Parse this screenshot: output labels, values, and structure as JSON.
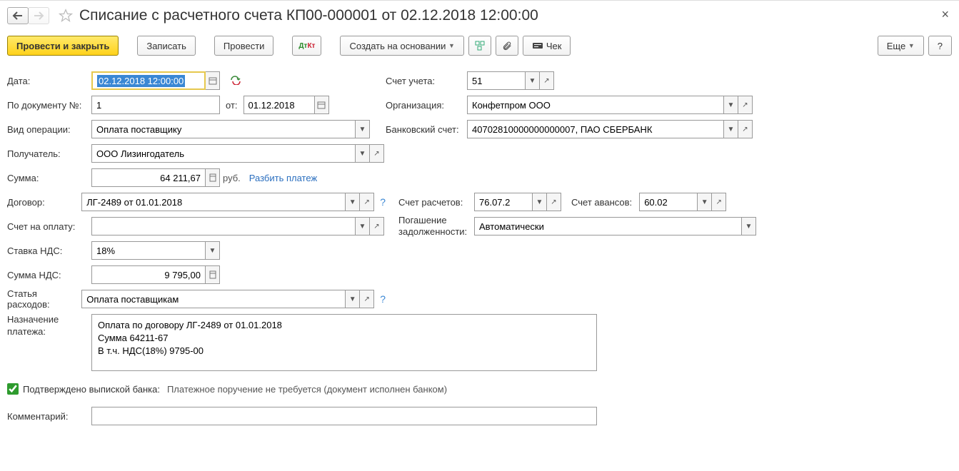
{
  "title": "Списание с расчетного счета КП00-000001 от 02.12.2018 12:00:00",
  "toolbar": {
    "post_and_close": "Провести и закрыть",
    "save": "Записать",
    "post": "Провести",
    "create_based": "Создать на основании",
    "check": "Чек",
    "more": "Еще",
    "help": "?"
  },
  "labels": {
    "date": "Дата:",
    "by_doc_no": "По документу №:",
    "from": "от:",
    "op_type": "Вид операции:",
    "recipient": "Получатель:",
    "amount": "Сумма:",
    "currency": "руб.",
    "split": "Разбить платеж",
    "contract": "Договор:",
    "invoice": "Счет на оплату:",
    "vat_rate": "Ставка НДС:",
    "vat_amount": "Сумма НДС:",
    "expense_item": "Статья расходов:",
    "purpose": "Назначение платежа:",
    "confirmed": "Подтверждено выпиской банка:",
    "confirmed_note": "Платежное поручение не требуется (документ исполнен банком)",
    "comment": "Комментарий:",
    "account": "Счет учета:",
    "org": "Организация:",
    "bank_acc": "Банковский счет:",
    "settle_acc": "Счет расчетов:",
    "advance_acc": "Счет авансов:",
    "debt_repay": "Погашение задолженности:"
  },
  "values": {
    "date": "02.12.2018 12:00:00",
    "doc_no": "1",
    "doc_date": "01.12.2018",
    "op_type": "Оплата поставщику",
    "recipient": "ООО Лизингодатель",
    "amount": "64 211,67",
    "contract": "ЛГ-2489 от 01.01.2018",
    "invoice": "",
    "vat_rate": "18%",
    "vat_amount": "9 795,00",
    "expense_item": "Оплата поставщикам",
    "purpose": "Оплата по договору ЛГ-2489 от 01.01.2018\nСумма 64211-67\nВ т.ч. НДС(18%) 9795-00",
    "comment": "",
    "account": "51",
    "org": "Конфетпром ООО",
    "bank_acc": "40702810000000000007, ПАО СБЕРБАНК",
    "settle_acc": "76.07.2",
    "advance_acc": "60.02",
    "debt_repay": "Автоматически"
  }
}
